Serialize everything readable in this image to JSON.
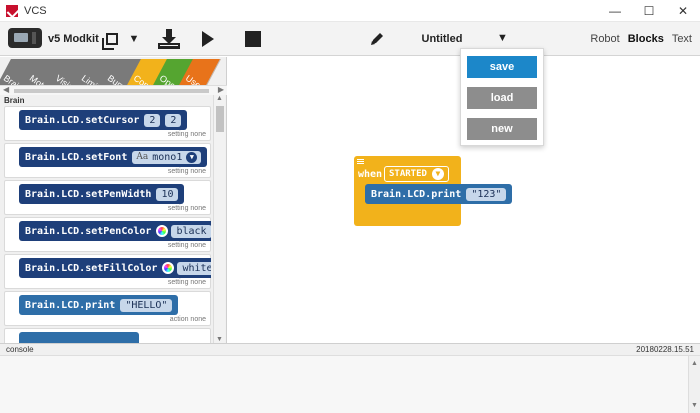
{
  "window": {
    "title": "VCS",
    "controls": {
      "minimize": "—",
      "maximize": "☐",
      "close": "✕"
    }
  },
  "toolbar": {
    "brand": "v5 Modkit",
    "icons": [
      "brain-icon",
      "copy-icon",
      "caret-down-icon",
      "download-icon",
      "play-icon",
      "stop-icon",
      "pencil-icon"
    ],
    "project_name": "Untitled",
    "view_tabs": [
      {
        "label": "Robot",
        "active": false
      },
      {
        "label": "Blocks",
        "active": true
      },
      {
        "label": "Text",
        "active": false
      }
    ]
  },
  "file_menu": {
    "items": [
      "save",
      "load",
      "new"
    ],
    "colors": {
      "save": "#1c87c9",
      "other": "#8d8d8d"
    }
  },
  "palette": {
    "categories": [
      {
        "label": "Brain",
        "color": "#7a7a7a"
      },
      {
        "label": "Motors",
        "color": "#7a7a7a"
      },
      {
        "label": "Vision",
        "color": "#7a7a7a"
      },
      {
        "label": "Limit",
        "color": "#7a7a7a"
      },
      {
        "label": "Bumper",
        "color": "#7a7a7a"
      },
      {
        "label": "Control",
        "color": "#f2b21b"
      },
      {
        "label": "Operators",
        "color": "#55a530"
      },
      {
        "label": "Users",
        "color": "#e8731a"
      }
    ],
    "section_label": "Brain",
    "blocks": [
      {
        "text": "Brain.LCD.setCursor",
        "args": [
          "2",
          "2"
        ],
        "note": "setting none"
      },
      {
        "text": "Brain.LCD.setFont",
        "select": "mono1",
        "select_prefix": "Aa",
        "note": "setting none"
      },
      {
        "text": "Brain.LCD.setPenWidth",
        "args": [
          "10"
        ],
        "note": "setting none"
      },
      {
        "text": "Brain.LCD.setPenColor",
        "color": "black",
        "note": "setting none"
      },
      {
        "text": "Brain.LCD.setFillColor",
        "color": "white",
        "note": "setting none"
      },
      {
        "text": "Brain.LCD.print",
        "args": [
          "\"HELLO\""
        ],
        "note": "action none"
      }
    ]
  },
  "workspace": {
    "event_block": {
      "when": "when",
      "event": "STARTED"
    },
    "inner_block": {
      "text": "Brain.LCD.print",
      "arg": "\"123\""
    }
  },
  "console": {
    "label": "console",
    "version": "20180228.15.51"
  }
}
